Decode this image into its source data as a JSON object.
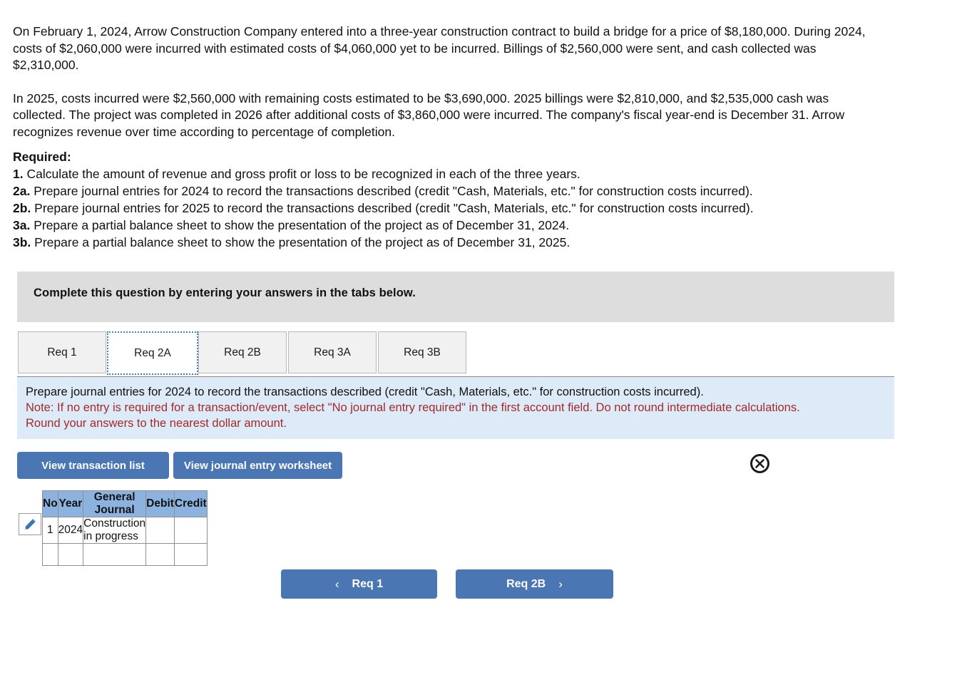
{
  "problem": {
    "paragraph1": "On February 1, 2024, Arrow Construction Company entered into a three-year construction contract to build a bridge for a price of $8,180,000. During 2024, costs of $2,060,000 were incurred with estimated costs of $4,060,000 yet to be incurred. Billings of $2,560,000 were sent, and cash collected was $2,310,000.",
    "paragraph2": "In 2025, costs incurred were $2,560,000 with remaining costs estimated to be $3,690,000. 2025 billings were $2,810,000, and $2,535,000 cash was collected. The project was completed in 2026 after additional costs of $3,860,000 were incurred. The company's fiscal year-end is December 31. Arrow recognizes revenue over time according to percentage of completion.",
    "required_label": "Required:",
    "requirements": [
      {
        "num": "1.",
        "text": "Calculate the amount of revenue and gross profit or loss to be recognized in each of the three years."
      },
      {
        "num": "2a.",
        "text": "Prepare journal entries for 2024 to record the transactions described (credit \"Cash, Materials, etc.\" for construction costs incurred)."
      },
      {
        "num": "2b.",
        "text": "Prepare journal entries for 2025 to record the transactions described (credit \"Cash, Materials, etc.\" for construction costs incurred)."
      },
      {
        "num": "3a.",
        "text": "Prepare a partial balance sheet to show the presentation of the project as of December 31, 2024."
      },
      {
        "num": "3b.",
        "text": "Prepare a partial balance sheet to show the presentation of the project as of December 31, 2025."
      }
    ]
  },
  "banner": {
    "text": "Complete this question by entering your answers in the tabs below."
  },
  "tabs": [
    {
      "label": "Req 1",
      "active": false
    },
    {
      "label": "Req 2A",
      "active": true
    },
    {
      "label": "Req 2B",
      "active": false
    },
    {
      "label": "Req 3A",
      "active": false
    },
    {
      "label": "Req 3B",
      "active": false
    }
  ],
  "instruction_panel": {
    "main": "Prepare journal entries for 2024 to record the transactions described (credit \"Cash, Materials, etc.\" for construction costs incurred).",
    "note": "Note: If no entry is required for a transaction/event, select \"No journal entry required\" in the first account field. Do not round intermediate calculations. Round your answers to the nearest dollar amount."
  },
  "toolbar": {
    "view_transaction_list": "View transaction list",
    "view_journal_entry_worksheet": "View journal entry worksheet",
    "close_icon": "close-circle-icon"
  },
  "journal_table": {
    "columns": [
      "No",
      "Year",
      "General Journal",
      "Debit",
      "Credit"
    ],
    "rows": [
      {
        "edit_icon": "pencil-icon",
        "no": "1",
        "year": "2024",
        "general_journal": "Construction in progress",
        "debit": "",
        "credit": ""
      },
      {
        "edit_icon": "",
        "no": "",
        "year": "",
        "general_journal": "",
        "debit": "",
        "credit": ""
      }
    ]
  },
  "navigation": {
    "prev_label": "Req 1",
    "prev_chevron": "‹",
    "next_label": "Req 2B",
    "next_chevron": "›"
  },
  "colors": {
    "banner_gray": "#dddddd",
    "panel_blue": "#ddeaf7",
    "note_red": "#a32a2a",
    "button_blue": "#4a77b4",
    "table_header_blue": "#8cb3e0",
    "tab_active_border": "#4a7ebb"
  }
}
